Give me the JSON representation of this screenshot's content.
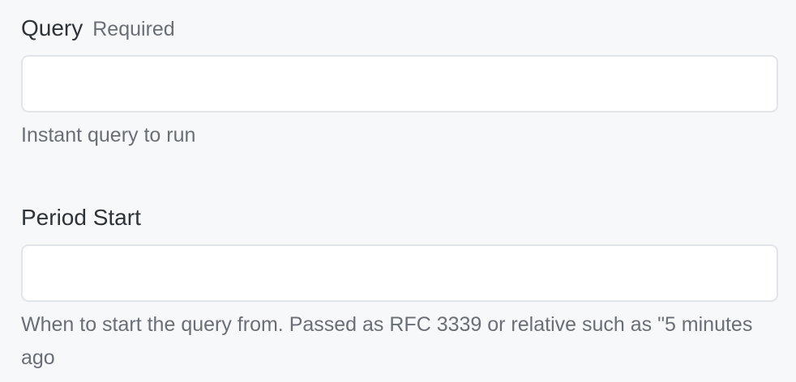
{
  "fields": {
    "query": {
      "label": "Query",
      "required_label": "Required",
      "value": "",
      "placeholder": "",
      "help": "Instant query to run"
    },
    "period_start": {
      "label": "Period Start",
      "value": "",
      "placeholder": "",
      "help": "When to start the query from. Passed as RFC 3339 or relative such as \"5 minutes ago"
    }
  }
}
